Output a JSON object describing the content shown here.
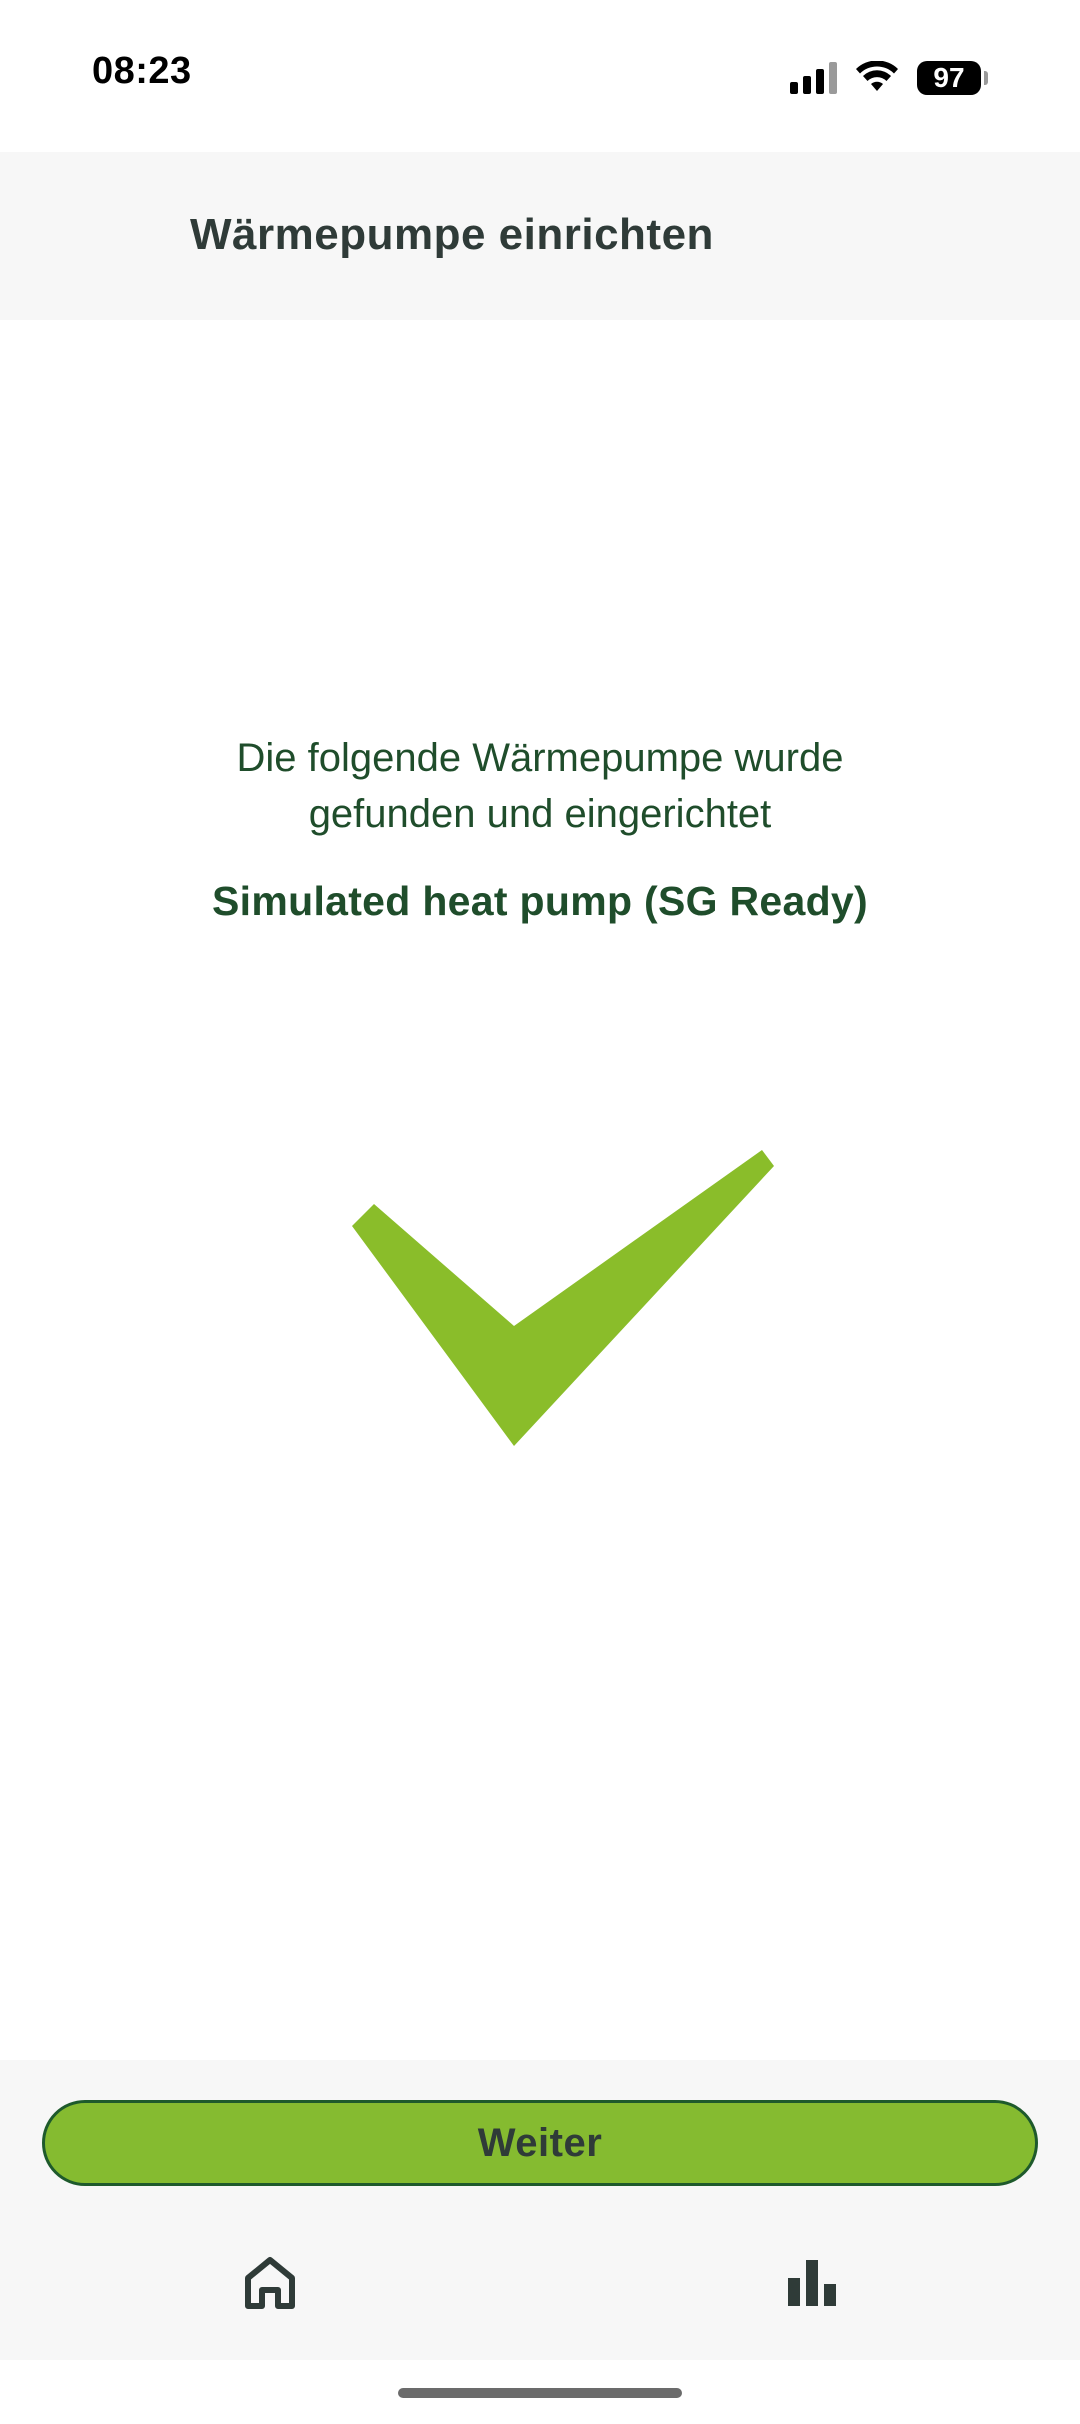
{
  "status_bar": {
    "time": "08:23",
    "battery_level": "97",
    "icons": [
      "signal-icon",
      "wifi-icon",
      "battery-icon"
    ]
  },
  "header": {
    "title": "Wärmepumpe einrichten"
  },
  "main": {
    "message_line1": "Die folgende Wärmepumpe wurde",
    "message_line2": "gefunden und eingerichtet",
    "device_name": "Simulated heat pump (SG Ready)",
    "success_icon": "checkmark-icon"
  },
  "footer": {
    "continue_label": "Weiter",
    "nav": [
      {
        "icon": "home-icon"
      },
      {
        "icon": "bar-chart-icon"
      }
    ]
  },
  "colors": {
    "accent_green": "#85bb30",
    "check_green": "#8abd2a",
    "dark_green_text": "#1f4d2b",
    "button_border": "#1e5a2c",
    "header_text": "#2f3b38"
  }
}
